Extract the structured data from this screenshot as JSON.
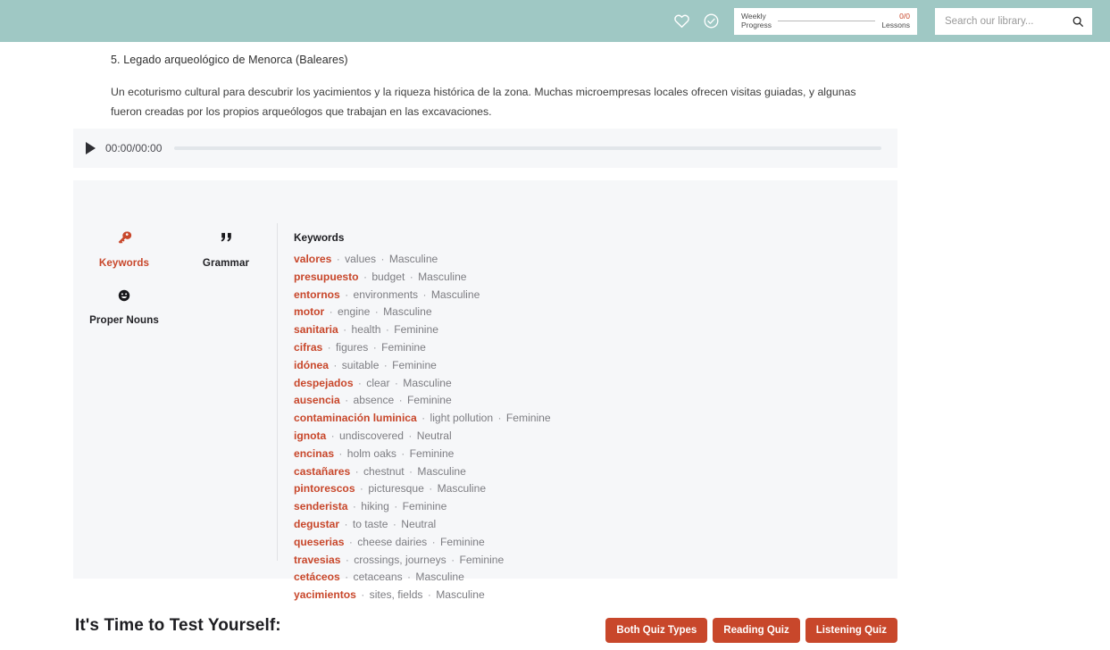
{
  "header": {
    "bg_color": "#9fc8c4",
    "icons": [
      {
        "name": "heart-icon",
        "title": "Favorites"
      },
      {
        "name": "check-circle-icon",
        "title": "Completed"
      }
    ],
    "progress": {
      "label_line1": "Weekly",
      "label_line2": "Progress",
      "count": "0/0",
      "count_label": "Lessons",
      "percent": 0,
      "accent_color": "#c8472b"
    },
    "search": {
      "placeholder": "Search our library...",
      "value": "",
      "icon": "search-icon"
    }
  },
  "lesson": {
    "title": "5. Legado arqueológico de Menorca (Baleares)",
    "body": "Un ecoturismo cultural para descubrir los yacimientos y la riqueza histórica de la zona. Muchas microempresas locales ofrecen visitas guiadas, y algunas fueron creadas por los propios arqueólogos que trabajan en las excavaciones."
  },
  "audio": {
    "play_icon": "play-icon",
    "time": "00:00/00:00",
    "progress_percent": 0
  },
  "panel": {
    "tabs": [
      {
        "label": "Keywords",
        "icon": "key-icon",
        "active": true
      },
      {
        "label": "Grammar",
        "icon": "quote-icon",
        "active": false
      },
      {
        "label": "Proper Nouns",
        "icon": "smiley-icon",
        "active": false
      }
    ],
    "heading": "Keywords",
    "accent_color": "#c8472b",
    "keywords": [
      {
        "term": "valores",
        "translation": "values",
        "gender": "Masculine"
      },
      {
        "term": "presupuesto",
        "translation": "budget",
        "gender": "Masculine"
      },
      {
        "term": "entornos",
        "translation": "environments",
        "gender": "Masculine"
      },
      {
        "term": "motor",
        "translation": "engine",
        "gender": "Masculine"
      },
      {
        "term": "sanitaria",
        "translation": "health",
        "gender": "Feminine"
      },
      {
        "term": "cifras",
        "translation": "figures",
        "gender": "Feminine"
      },
      {
        "term": "idónea",
        "translation": "suitable",
        "gender": "Feminine"
      },
      {
        "term": "despejados",
        "translation": "clear",
        "gender": "Masculine"
      },
      {
        "term": "ausencia",
        "translation": "absence",
        "gender": "Feminine"
      },
      {
        "term": "contaminación luminica",
        "translation": "light pollution",
        "gender": "Feminine"
      },
      {
        "term": "ignota",
        "translation": "undiscovered",
        "gender": "Neutral"
      },
      {
        "term": "encinas",
        "translation": "holm oaks",
        "gender": "Feminine"
      },
      {
        "term": "castañares",
        "translation": "chestnut",
        "gender": "Masculine"
      },
      {
        "term": "pintorescos",
        "translation": "picturesque",
        "gender": "Masculine"
      },
      {
        "term": "senderista",
        "translation": "hiking",
        "gender": "Feminine"
      },
      {
        "term": "degustar",
        "translation": "to taste",
        "gender": "Neutral"
      },
      {
        "term": "queserias",
        "translation": "cheese dairies",
        "gender": "Feminine"
      },
      {
        "term": "travesias",
        "translation": "crossings, journeys",
        "gender": "Feminine"
      },
      {
        "term": "cetáceos",
        "translation": "cetaceans",
        "gender": "Masculine"
      },
      {
        "term": "yacimientos",
        "translation": "sites, fields",
        "gender": "Masculine"
      }
    ]
  },
  "quiz": {
    "title": "It's Time to Test Yourself:",
    "buttons": [
      {
        "label": "Both Quiz Types"
      },
      {
        "label": "Reading Quiz"
      },
      {
        "label": "Listening Quiz"
      }
    ],
    "button_color": "#c8472b"
  }
}
